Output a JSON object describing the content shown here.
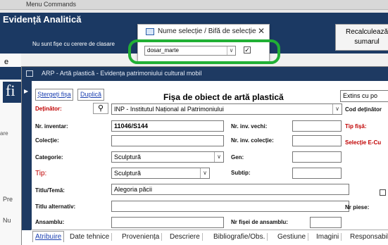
{
  "menu": {
    "title": "Menu Commands"
  },
  "app": {
    "title": "Evidență Analitică",
    "subtitle": "Nu sunt fișe cu cerere de clasare",
    "recalc_button": "Recalculează sumarul"
  },
  "background": {
    "e": "e",
    "fi": "fi",
    "are": "are",
    "pre": "Pre",
    "nu": "Nu"
  },
  "popup": {
    "title": "Nume selecție / Bifă de selecție",
    "close": "✕",
    "value": "dosar_marte",
    "checked": "✓"
  },
  "form": {
    "window_title": "ARP - Artă plastică - Evidența patrimoniului cultural mobil",
    "heading": "Fișa de obiect de artă plastică",
    "delete_button": "Ștergeți fișa",
    "duplicate_button": "Duplică",
    "extins": "Extins cu po",
    "labels": {
      "detinator": "Deținător:",
      "nr_inventar": "Nr. inventar:",
      "colectie": "Colecție:",
      "categorie": "Categorie:",
      "tip": "Tip:",
      "titlu": "Titlu/Temă:",
      "titlu_alt": "Titlu alternativ:",
      "ansamblu": "Ansamblu:",
      "nr_inv_vechi": "Nr. inv. vechi:",
      "nr_inv_colectie": "Nr. inv. colecție:",
      "gen": "Gen:",
      "subtip": "Subtip:",
      "nr_fisei": "Nr fișei de ansamblu:",
      "cod_detinator": "Cod deținător",
      "tip_fisa": "Tip fișă:",
      "selectie": "Selecție E-Cu",
      "nr_piese": "Nr piese:"
    },
    "values": {
      "detinator": "INP - Institutul Național al Patrimoniului",
      "nr_inventar": "11046/S144",
      "categorie": "Sculptură",
      "tip": "Sculptură",
      "titlu": "Alegoria păcii"
    }
  },
  "tabs": [
    "Atribuire",
    "Date tehnice",
    "Proveniența",
    "Descriere",
    "Bibliografie/Obs.",
    "Gestiune",
    "Imagini",
    "Responsabilitat"
  ]
}
